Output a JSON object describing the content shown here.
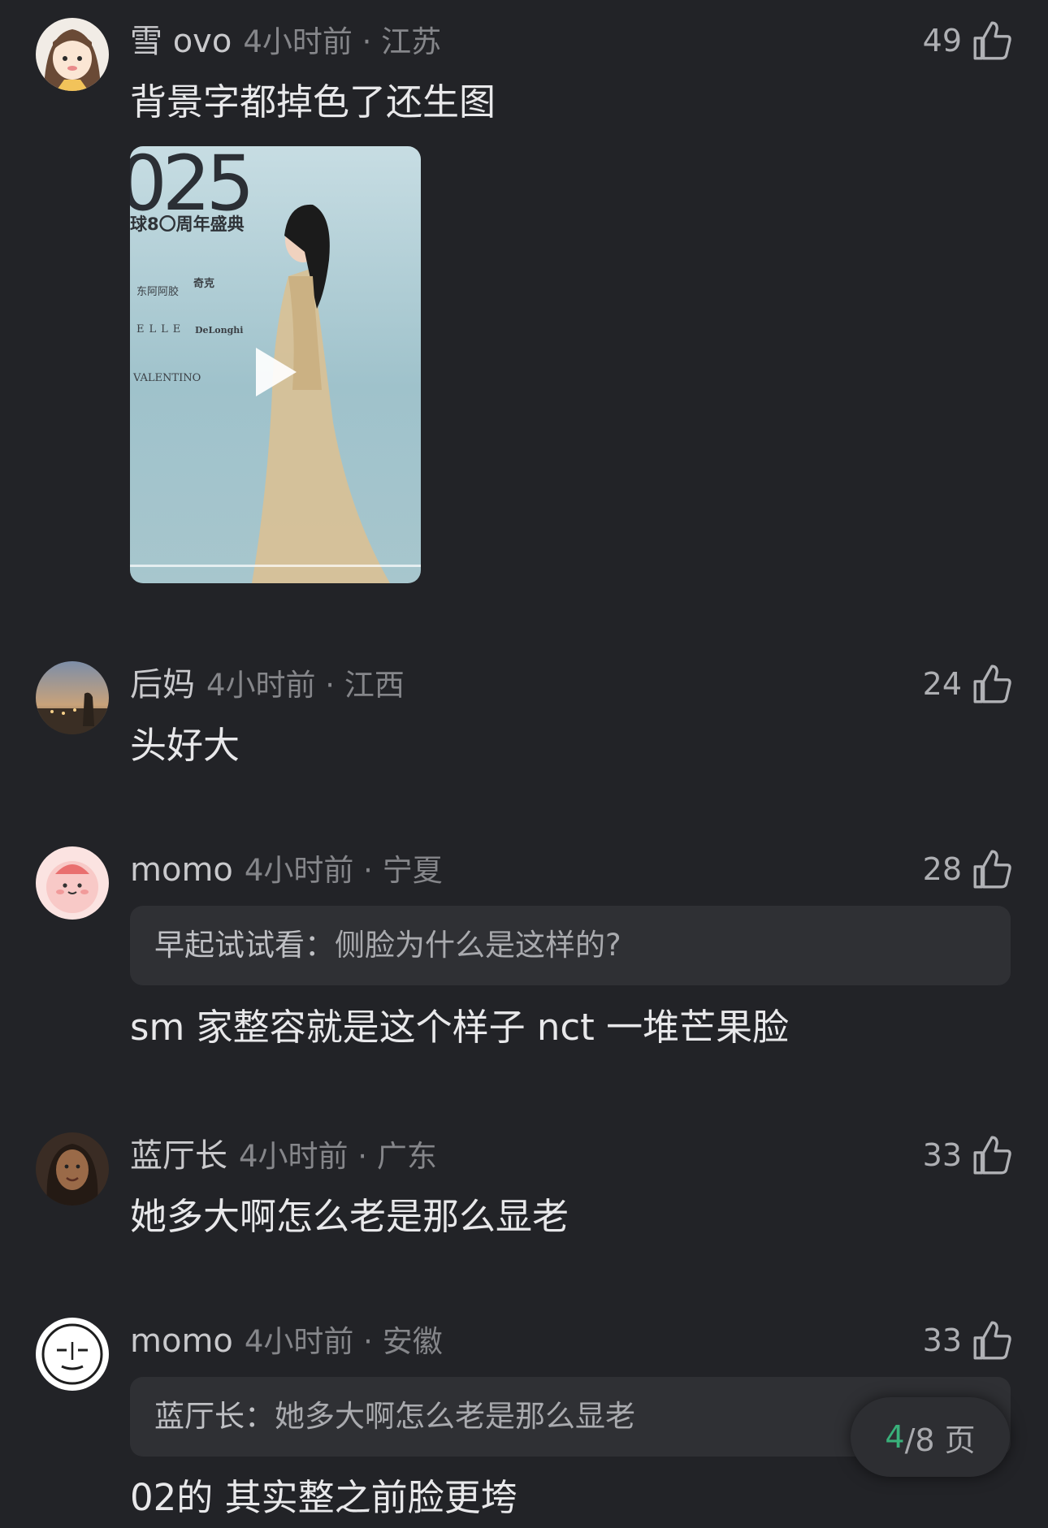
{
  "comments": [
    {
      "username": "雪 ovo",
      "time_location": "4小时前 · 江苏",
      "likes": "49",
      "text": "背景字都掉色了还生图",
      "media": {
        "type": "video",
        "big_text": "025",
        "sub_text": "球8〇周年盛典",
        "sponsors": [
          "东阿阿胶",
          "奇克",
          "ELLE",
          "DeLonghi",
          "VALENTINO"
        ]
      }
    },
    {
      "username": "后妈",
      "time_location": "4小时前 · 江西",
      "likes": "24",
      "text": "头好大"
    },
    {
      "username": "momo",
      "time_location": "4小时前 · 宁夏",
      "likes": "28",
      "quote": {
        "name": "早起试试看：",
        "text": "侧脸为什么是这样的?"
      },
      "text": "sm 家整容就是这个样子 nct 一堆芒果脸"
    },
    {
      "username": "蓝厅长",
      "time_location": "4小时前 · 广东",
      "likes": "33",
      "text": "她多大啊怎么老是那么显老"
    },
    {
      "username": "momo",
      "time_location": "4小时前 · 安徽",
      "likes": "33",
      "quote": {
        "name": "蓝厅长：",
        "text": "她多大啊怎么老是那么显老"
      },
      "text": "02的 其实整之前脸更垮"
    }
  ],
  "pager": {
    "current": "4",
    "total": "/8 页"
  },
  "icons": {
    "like": "thumbs-up-icon",
    "play": "play-icon"
  },
  "colors": {
    "background": "#222327",
    "accent": "#39b07a"
  }
}
